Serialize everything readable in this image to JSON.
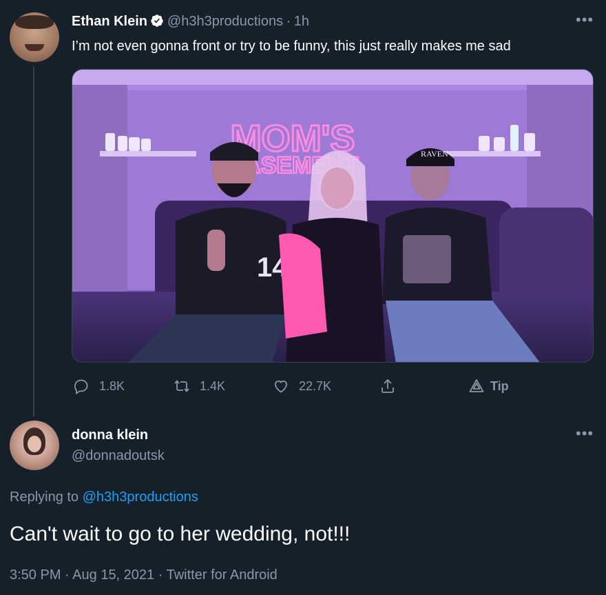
{
  "tweet": {
    "author_name": "Ethan Klein",
    "handle": "@h3h3productions",
    "separator": "·",
    "time": "1h",
    "verified": true,
    "text": "I’m not even gonna front or try to be funny, this just really makes me sad",
    "media": {
      "neon_sign_line1": "MOM'S",
      "neon_sign_line2": "BASEMENT",
      "hat_text": "RAVEN",
      "jersey_number": "14"
    },
    "actions": {
      "replies": "1.8K",
      "retweets": "1.4K",
      "likes": "22.7K",
      "tip_label": "Tip"
    },
    "more_icon": "more-horizontal-icon"
  },
  "reply": {
    "author_name": "donna klein",
    "handle": "@donnadoutsk",
    "replying_prefix": "Replying to",
    "replying_handle": "@h3h3productions",
    "text": "Can't wait to go to her wedding, not!!!",
    "time": "3:50 PM",
    "date": "Aug 15, 2021",
    "source": "Twitter for Android",
    "separator": "·"
  },
  "colors": {
    "background": "#15202b",
    "secondary_text": "#8899a6",
    "link": "#1da1f2",
    "border": "#38444d"
  }
}
